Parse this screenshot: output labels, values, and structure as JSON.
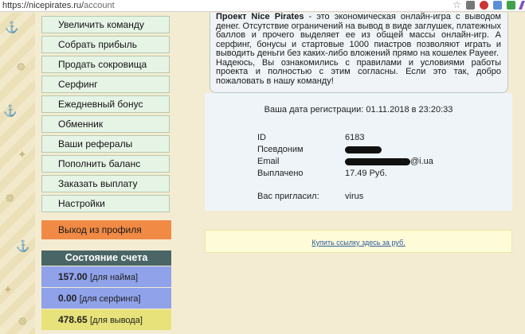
{
  "browser": {
    "url_host": "https://nicepirates.ru/",
    "url_path": "account"
  },
  "menu": {
    "items": [
      {
        "label": "Увеличить команду"
      },
      {
        "label": "Собрать прибыль"
      },
      {
        "label": "Продать сокровища"
      },
      {
        "label": "Серфинг"
      },
      {
        "label": "Ежедневный бонус"
      },
      {
        "label": "Обменник"
      },
      {
        "label": "Ваши рефералы"
      },
      {
        "label": "Пополнить баланс"
      },
      {
        "label": "Заказать выплату"
      },
      {
        "label": "Настройки"
      }
    ],
    "logout": "Выход из профиля"
  },
  "account": {
    "title": "Состояние счета",
    "rows": [
      {
        "value": "157.00",
        "label": "[для найма]"
      },
      {
        "value": "0.00",
        "label": "[для серфинга]"
      },
      {
        "value": "478.65",
        "label": "[для вывода]"
      }
    ]
  },
  "intro": {
    "title": "Проект Nice Pirates",
    "text1": " - это экономическая онлайн-игра с выводом денег. Отсутствие ограничений на вывод в виде заглушек, платежных баллов и прочего выделяет ее из общей массы онлайн-игр. А серфинг, бонусы и стартовые 1000 пиастров позволяют играть и выводить деньги без каких-либо вложений прямо на кошелек Payeer.",
    "text2": "Надеюсь, Вы ознакомились с правилами и условиями работы проекта и полностью с этим согласны. Если это так, добро пожаловать в нашу команду!"
  },
  "registration": {
    "date_text": "Ваша дата регистрации: 01.11.2018 в 23:20:33",
    "id_label": "ID",
    "id_value": "6183",
    "nick_label": "Псевдоним",
    "email_label": "Email",
    "email_suffix": "@i.ua",
    "paid_label": "Выплачено",
    "paid_value": "17.49 Руб.",
    "ref_label": "Вас пригласил:",
    "ref_value": "virus"
  },
  "note": {
    "link": "Купить ссылку здесь за руб."
  }
}
